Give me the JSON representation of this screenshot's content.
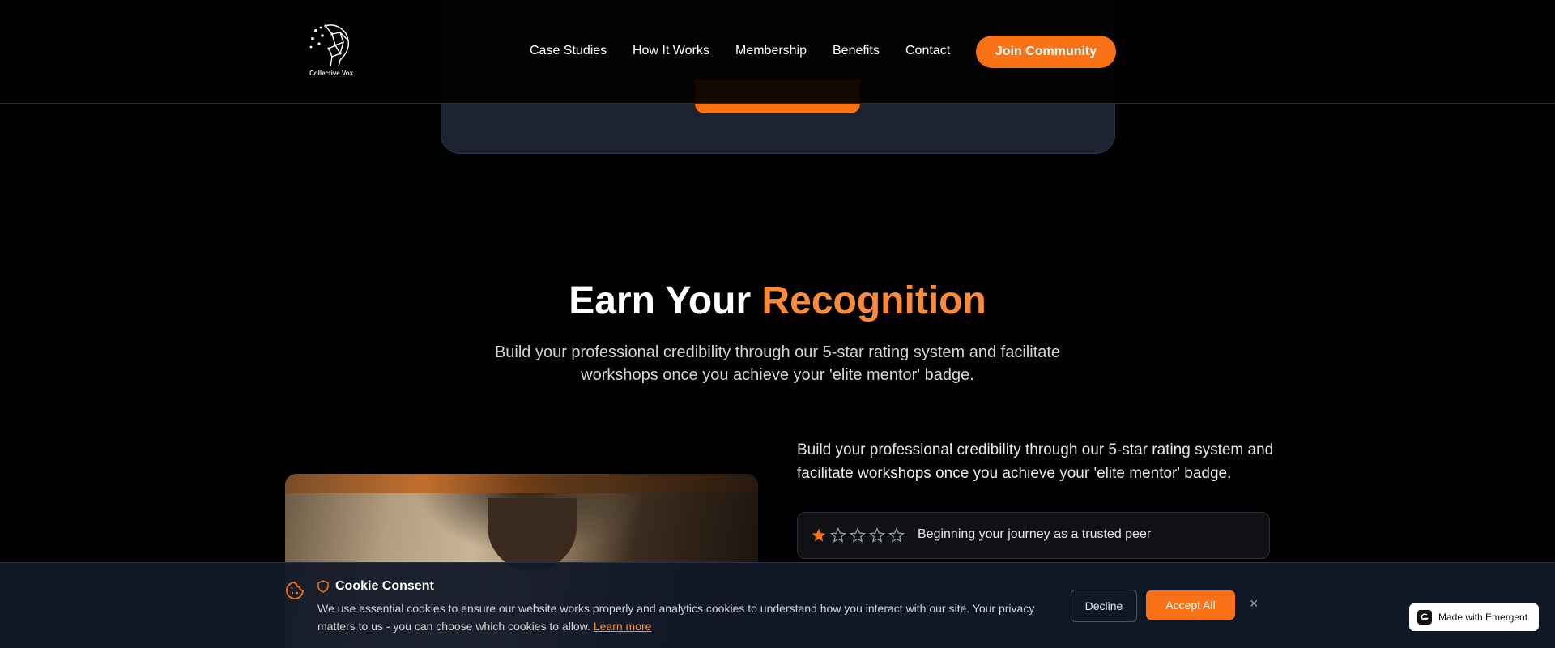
{
  "brand": {
    "name": "Collective Vox"
  },
  "nav": {
    "items": [
      {
        "label": "Case Studies"
      },
      {
        "label": "How It Works"
      },
      {
        "label": "Membership"
      },
      {
        "label": "Benefits"
      },
      {
        "label": "Contact"
      }
    ],
    "cta_label": "Join Community"
  },
  "section": {
    "title_white": "Earn Your",
    "title_accent": "Recognition",
    "subtitle": "Build your professional credibility through our 5-star rating system and facilitate workshops once you achieve your 'elite mentor' badge."
  },
  "detail": {
    "text": "Build your professional credibility through our 5-star rating system and facilitate workshops once you achieve your 'elite mentor' badge.",
    "rating": {
      "filled": 1,
      "total": 5,
      "label": "Beginning your journey as a trusted peer"
    }
  },
  "cookie": {
    "title": "Cookie Consent",
    "body": "We use essential cookies to ensure our website works properly and analytics cookies to understand how you interact with our site. Your privacy matters to us - you can choose which cookies to allow.",
    "learn_more": "Learn more",
    "decline_label": "Decline",
    "accept_label": "Accept All",
    "close_glyph": "×"
  },
  "badge": {
    "label": "Made with Emergent"
  },
  "colors": {
    "accent": "#f97316",
    "background": "#000000",
    "banner": "#111827"
  }
}
